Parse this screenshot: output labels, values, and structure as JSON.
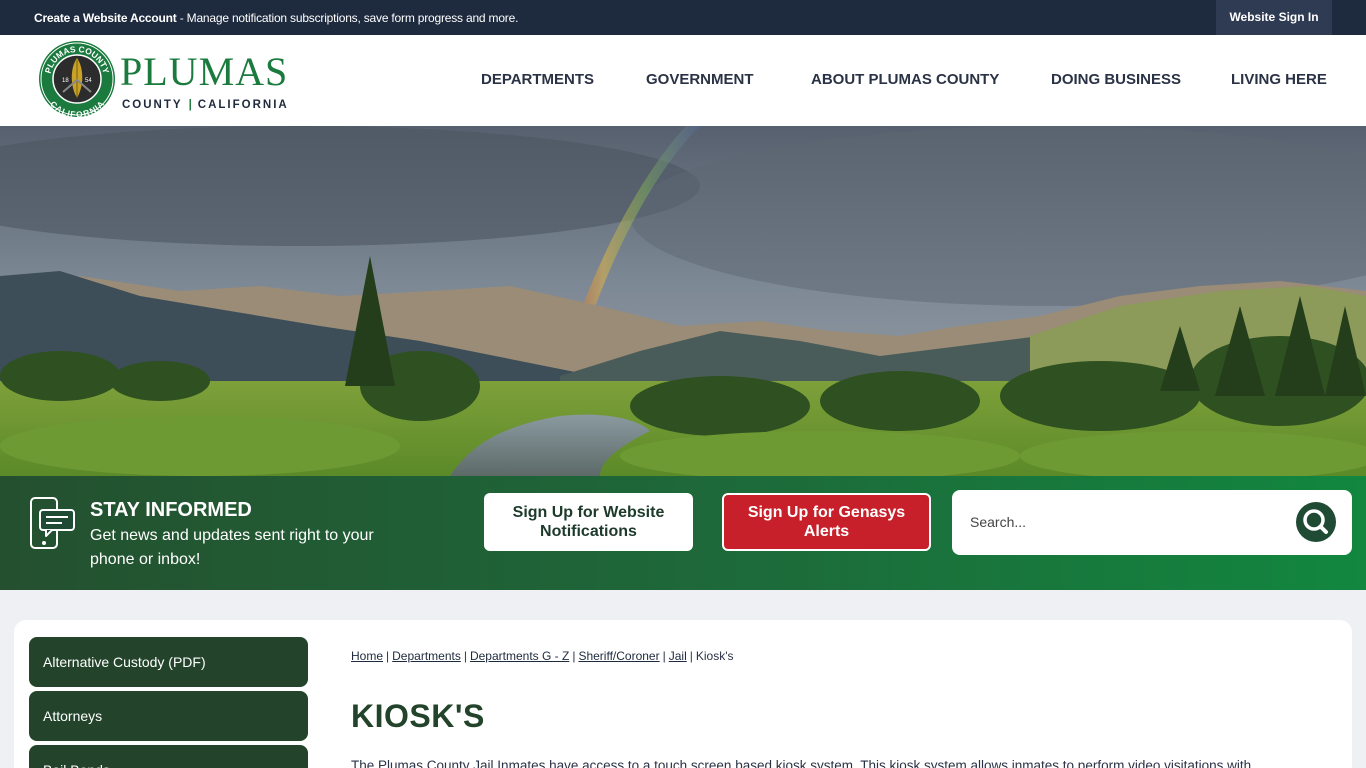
{
  "topbar": {
    "notice_bold": "Create a Website Account",
    "notice_rest": " - Manage notification subscriptions, save form progress and more.",
    "signin_label": "Website Sign In"
  },
  "logo": {
    "name": "PLUMAS",
    "sub_left": "COUNTY",
    "sub_sep": "|",
    "sub_right": "CALIFORNIA",
    "seal_top": "PLUMAS COUNTY",
    "seal_bottom": "CALIFORNIA",
    "seal_year_left": "18",
    "seal_year_right": "54"
  },
  "nav": {
    "items": [
      {
        "label": "DEPARTMENTS"
      },
      {
        "label": "GOVERNMENT"
      },
      {
        "label": "ABOUT PLUMAS COUNTY"
      },
      {
        "label": "DOING BUSINESS"
      },
      {
        "label": "LIVING HERE"
      }
    ]
  },
  "informed": {
    "title": "STAY INFORMED",
    "text": "Get news and updates sent right to your phone or inbox!",
    "notify_label": "Sign Up for Website Notifications",
    "alerts_label": "Sign Up for Genasys Alerts",
    "search_placeholder": "Search...",
    "search_icon": "search-icon"
  },
  "sidebar": {
    "items": [
      {
        "label": "Alternative Custody (PDF)"
      },
      {
        "label": "Attorneys"
      },
      {
        "label": "Bail Bonds"
      }
    ]
  },
  "breadcrumb": {
    "items": [
      {
        "label": "Home"
      },
      {
        "label": "Departments"
      },
      {
        "label": "Departments G - Z"
      },
      {
        "label": "Sheriff/Coroner"
      },
      {
        "label": "Jail"
      }
    ],
    "current": "Kiosk's"
  },
  "main": {
    "title": "KIOSK'S",
    "intro": "The Plumas County Jail Inmates have access to a touch screen based kiosk system. This kiosk system allows inmates to perform video visitations with"
  },
  "colors": {
    "topbar": "#1e2a3e",
    "brand_green": "#1b7a3e",
    "dark_green": "#23442b",
    "alert_red": "#c8202a"
  }
}
